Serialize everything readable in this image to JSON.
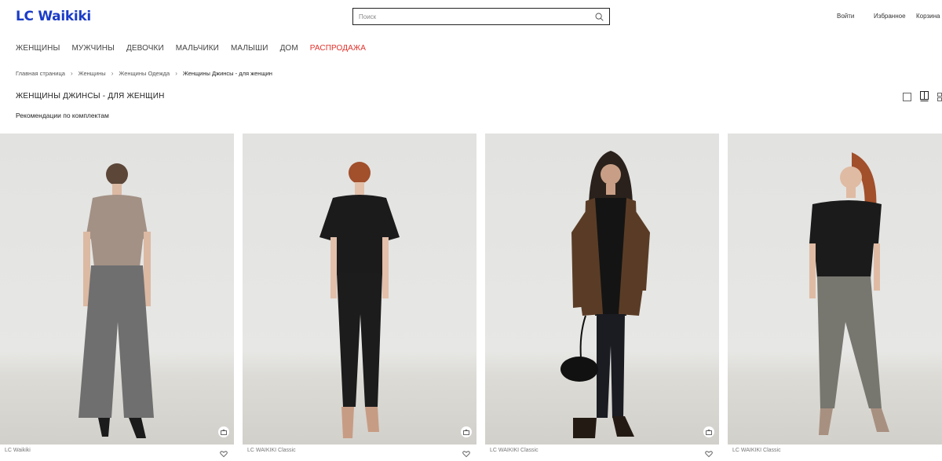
{
  "header": {
    "logo": "LC Waikiki",
    "search_placeholder": "Поиск",
    "login_label": "Войти",
    "favorites_label": "Избранное",
    "cart_label": "Корзина"
  },
  "nav": {
    "items": [
      {
        "label": "ЖЕНЩИНЫ"
      },
      {
        "label": "МУЖЧИНЫ"
      },
      {
        "label": "ДЕВОЧКИ"
      },
      {
        "label": "МАЛЬЧИКИ"
      },
      {
        "label": "МАЛЫШИ"
      },
      {
        "label": "ДОМ"
      },
      {
        "label": "РАСПРОДАЖА"
      }
    ]
  },
  "breadcrumb": [
    "Главная страница",
    "Женщины",
    "Женщины Одежда",
    "Женщины Джинсы - для женщин"
  ],
  "page": {
    "title": "ЖЕНЩИНЫ ДЖИНСЫ - ДЛЯ ЖЕНЩИН",
    "subtitle": "Рекомендации по комплектам"
  },
  "products": [
    {
      "brand": "LC Waikiki",
      "top_color": "#a39185",
      "bottom_color": "#6f6f6f",
      "fit": "wide-leg"
    },
    {
      "brand": "LC WAIKIKI Classic",
      "top_color": "#1b1b1b",
      "bottom_color": "#1c1c1c",
      "fit": "slim"
    },
    {
      "brand": "LC WAIKIKI Classic",
      "top_color": "#1b1b1b",
      "bottom_color": "#1a1c22",
      "fit": "skinny",
      "jacket_color": "#5a3c26"
    },
    {
      "brand": "LC WAIKIKI Classic",
      "top_color": "#1b1b1b",
      "bottom_color": "#77766f",
      "fit": "slim"
    }
  ]
}
